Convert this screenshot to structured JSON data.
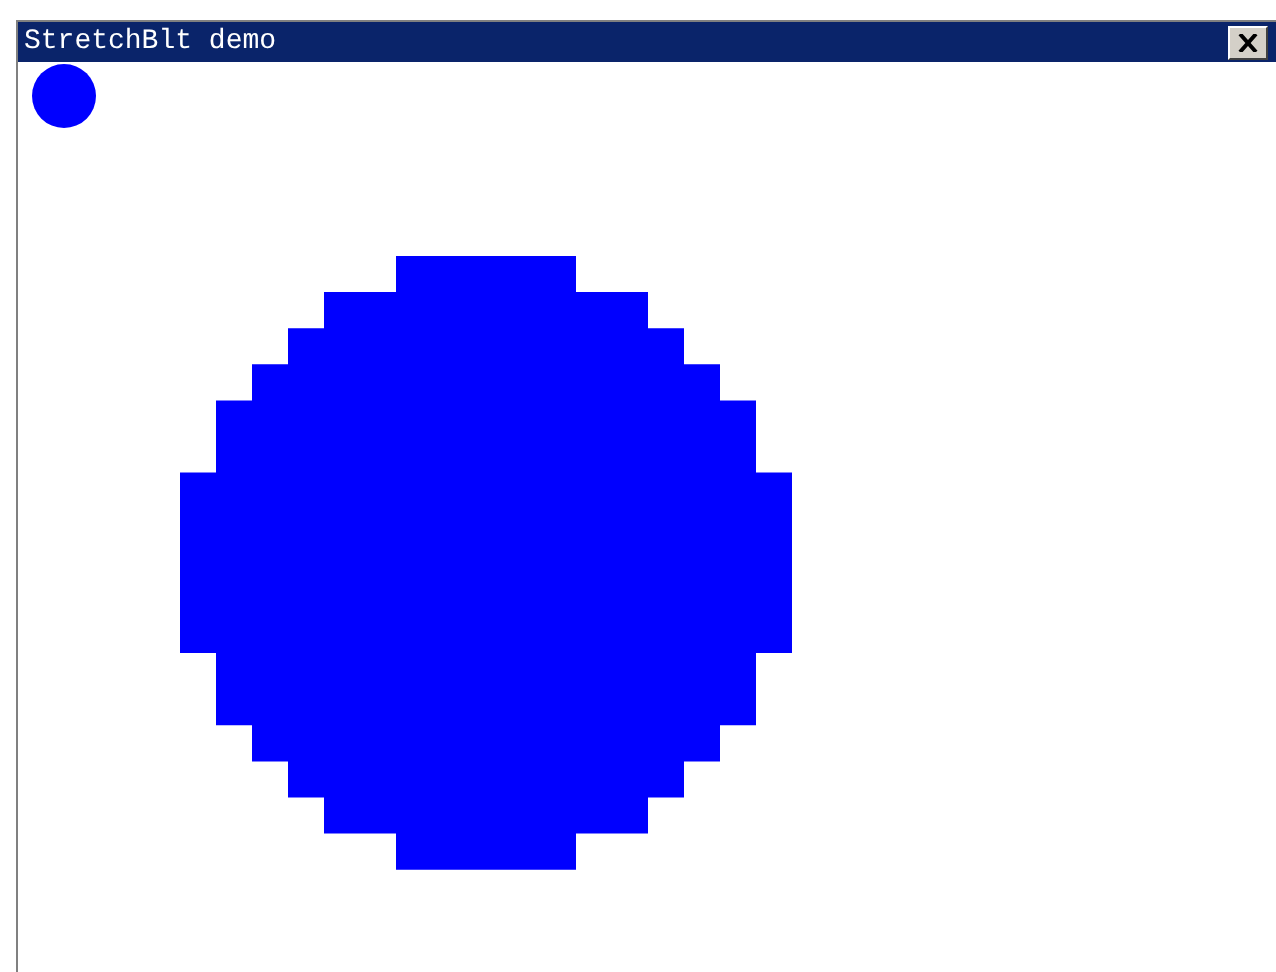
{
  "window": {
    "title": "StretchBlt demo"
  }
}
